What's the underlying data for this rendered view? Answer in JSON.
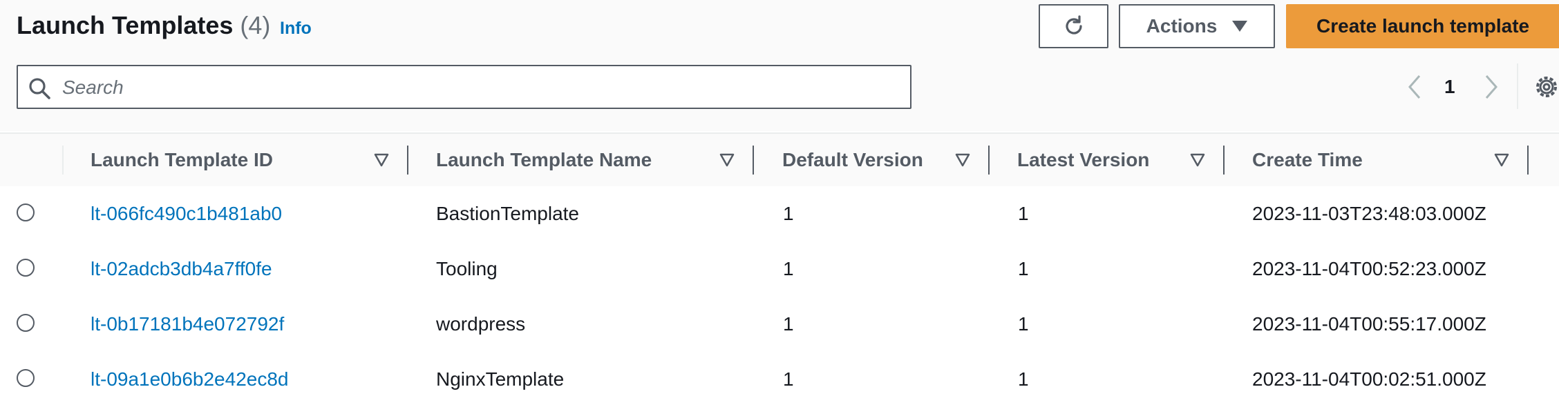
{
  "header": {
    "title": "Launch Templates",
    "count": "(4)",
    "info_label": "Info",
    "refresh_icon": "refresh-icon",
    "actions_label": "Actions",
    "create_label": "Create launch template",
    "accent_color": "#ec9b3b",
    "link_color": "#0073bb"
  },
  "search": {
    "placeholder": "Search",
    "value": ""
  },
  "pagination": {
    "current_page": "1"
  },
  "table": {
    "columns": [
      {
        "label": "Launch Template ID"
      },
      {
        "label": "Launch Template Name"
      },
      {
        "label": "Default Version"
      },
      {
        "label": "Latest Version"
      },
      {
        "label": "Create Time"
      }
    ],
    "rows": [
      {
        "id": "lt-066fc490c1b481ab0",
        "name": "BastionTemplate",
        "default_version": "1",
        "latest_version": "1",
        "create_time": "2023-11-03T23:48:03.000Z"
      },
      {
        "id": "lt-02adcb3db4a7ff0fe",
        "name": "Tooling",
        "default_version": "1",
        "latest_version": "1",
        "create_time": "2023-11-04T00:52:23.000Z"
      },
      {
        "id": "lt-0b17181b4e072792f",
        "name": "wordpress",
        "default_version": "1",
        "latest_version": "1",
        "create_time": "2023-11-04T00:55:17.000Z"
      },
      {
        "id": "lt-09a1e0b6b2e42ec8d",
        "name": "NginxTemplate",
        "default_version": "1",
        "latest_version": "1",
        "create_time": "2023-11-04T00:02:51.000Z"
      }
    ]
  }
}
